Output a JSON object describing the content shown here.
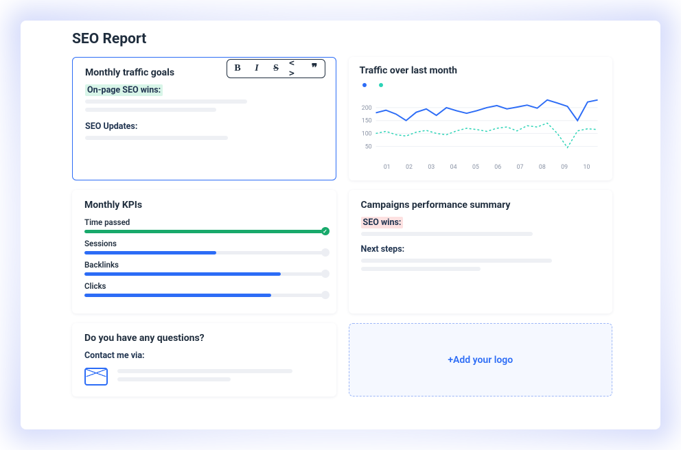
{
  "title": "SEO Report",
  "toolbar": {
    "bold": "B",
    "italic": "I",
    "strike": "S",
    "code": "< >",
    "quote": "❞"
  },
  "goals": {
    "title": "Monthly traffic goals",
    "section1": "On-page SEO wins:",
    "section2": "SEO Updates:"
  },
  "traffic": {
    "title": "Traffic over last month",
    "legend": {
      "series1_color": "#2c6cf6",
      "series2_color": "#2bd3b6"
    }
  },
  "kpis": {
    "title": "Monthly KPIs",
    "rows": [
      {
        "label": "Time passed",
        "value": 100,
        "color": "#18a96b",
        "checked": true
      },
      {
        "label": "Sessions",
        "value": 55,
        "color": "#2c6cf6",
        "checked": false
      },
      {
        "label": "Backlinks",
        "value": 82,
        "color": "#2c6cf6",
        "checked": false
      },
      {
        "label": "Clicks",
        "value": 78,
        "color": "#2c6cf6",
        "checked": false
      }
    ]
  },
  "campaigns": {
    "title": "Campaigns performance summary",
    "section1": "SEO wins:",
    "section2": "Next steps:"
  },
  "contact": {
    "title": "Do you have any questions?",
    "sub": "Contact me via:"
  },
  "logo": {
    "cta": "+Add your logo"
  },
  "chart_data": {
    "type": "line",
    "x": [
      "01",
      "02",
      "03",
      "04",
      "05",
      "06",
      "07",
      "08",
      "09",
      "10"
    ],
    "y_ticks": [
      50,
      100,
      150,
      200
    ],
    "ylim": [
      0,
      250
    ],
    "series": [
      {
        "name": "series1",
        "color": "#2c6cf6",
        "style": "solid",
        "values": [
          180,
          190,
          175,
          150,
          182,
          195,
          170,
          200,
          188,
          178,
          188,
          200,
          208,
          195,
          202,
          210,
          198,
          230,
          218,
          205,
          150,
          222,
          230
        ]
      },
      {
        "name": "series2",
        "color": "#2bd3b6",
        "style": "dashed",
        "values": [
          100,
          108,
          95,
          90,
          105,
          112,
          100,
          95,
          110,
          120,
          115,
          108,
          120,
          125,
          110,
          130,
          125,
          140,
          100,
          45,
          110,
          118,
          115
        ]
      }
    ]
  }
}
